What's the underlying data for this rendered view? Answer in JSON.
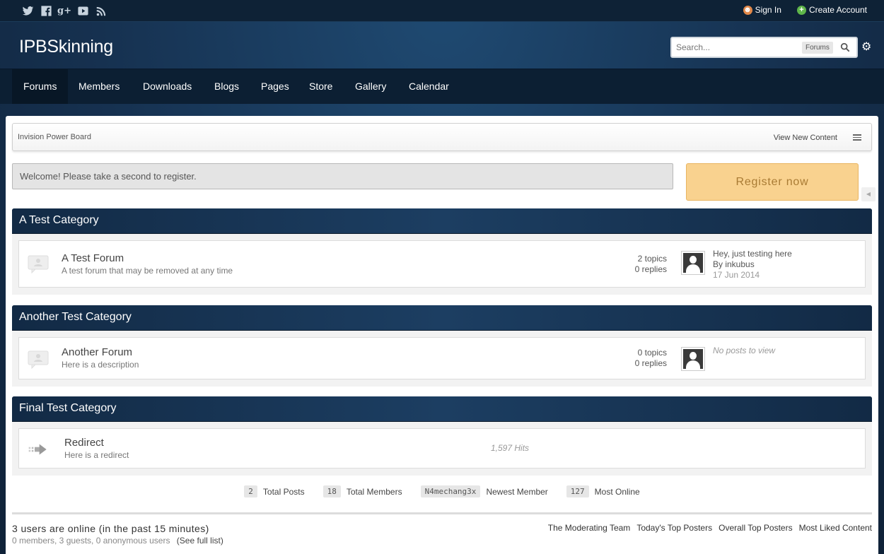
{
  "topbar": {
    "social": [
      "twitter-icon",
      "facebook-icon",
      "google-plus-icon",
      "youtube-icon",
      "rss-icon"
    ],
    "sign_in": "Sign In",
    "create_account": "Create Account"
  },
  "header": {
    "brand": "IPBSkinning",
    "search_placeholder": "Search...",
    "search_scope": "Forums"
  },
  "nav": {
    "tabs": [
      "Forums",
      "Members",
      "Downloads",
      "Blogs",
      "Pages",
      "Store",
      "Gallery",
      "Calendar"
    ],
    "active": "Forums"
  },
  "breadcrumb": {
    "home": "Invision Power Board",
    "view_new": "View New Content"
  },
  "welcome": {
    "message": "Welcome! Please take a second to register.",
    "register": "Register now"
  },
  "categories": [
    {
      "title": "A Test Category",
      "forum": {
        "name": "A Test Forum",
        "desc": "A test forum that may be removed at any time",
        "topics": "2 topics",
        "replies": "0 replies",
        "last_title": "Hey, just testing here",
        "last_by": "By inkubus",
        "last_date": "17 Jun 2014"
      }
    },
    {
      "title": "Another Test Category",
      "forum": {
        "name": "Another Forum",
        "desc": "Here is a description",
        "topics": "0 topics",
        "replies": "0 replies",
        "no_posts": "No posts to view"
      }
    },
    {
      "title": "Final Test Category",
      "forum": {
        "name": "Redirect",
        "desc": "Here is a redirect",
        "hits": "1,597 Hits"
      }
    }
  ],
  "stats": {
    "total_posts": {
      "value": "2",
      "label": "Total Posts"
    },
    "total_members": {
      "value": "18",
      "label": "Total Members"
    },
    "newest_member": {
      "value": "N4mechang3x",
      "label": "Newest Member"
    },
    "most_online": {
      "value": "127",
      "label": "Most Online"
    }
  },
  "online": {
    "title": "3 users are online (in the past 15 minutes)",
    "breakdown": "0 members, 3 guests, 0 anonymous users",
    "full_list": "(See full list)"
  },
  "footer_links": [
    "The Moderating Team",
    "Today's Top Posters",
    "Overall Top Posters",
    "Most Liked Content"
  ]
}
